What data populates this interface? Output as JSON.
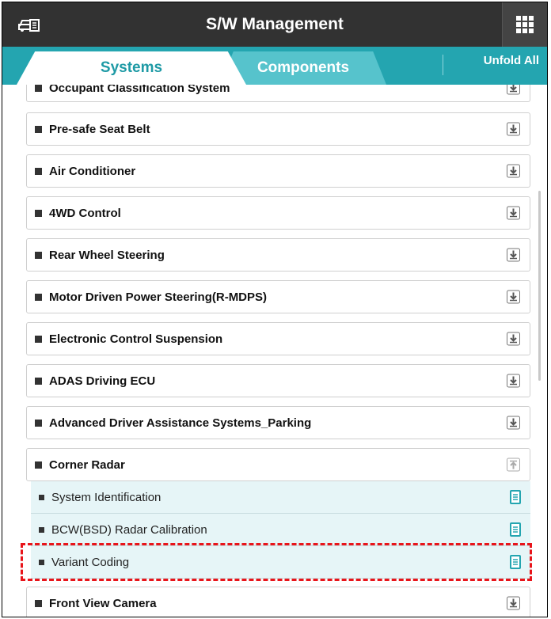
{
  "header": {
    "title": "S/W Management",
    "car_icon": "car-document-icon",
    "grid_icon": "grid-menu-icon"
  },
  "tabs": [
    {
      "label": "Systems",
      "active": true
    },
    {
      "label": "Components",
      "active": false
    }
  ],
  "unfold_label": "Unfold All",
  "systems": [
    {
      "label": "Occupant Classification System",
      "expanded": false
    },
    {
      "label": "Pre-safe Seat Belt",
      "expanded": false
    },
    {
      "label": "Air Conditioner",
      "expanded": false
    },
    {
      "label": "4WD Control",
      "expanded": false
    },
    {
      "label": "Rear Wheel Steering",
      "expanded": false
    },
    {
      "label": "Motor Driven Power Steering(R-MDPS)",
      "expanded": false
    },
    {
      "label": "Electronic Control Suspension",
      "expanded": false
    },
    {
      "label": "ADAS Driving ECU",
      "expanded": false
    },
    {
      "label": "Advanced Driver Assistance Systems_Parking",
      "expanded": false
    },
    {
      "label": "Corner Radar",
      "expanded": true
    },
    {
      "label": "Front View Camera",
      "expanded": false
    }
  ],
  "corner_radar_items": [
    {
      "label": "System Identification"
    },
    {
      "label": "BCW(BSD) Radar Calibration"
    },
    {
      "label": "Variant Coding",
      "highlighted": true
    }
  ],
  "colors": {
    "header_bg": "#323232",
    "tab_bar_bg": "#24a5b0",
    "active_tab_text": "#1e9aa5",
    "inactive_tab_bg": "#56c3cc",
    "sub_item_bg": "#e6f5f7",
    "highlight_border": "#e8141a"
  }
}
